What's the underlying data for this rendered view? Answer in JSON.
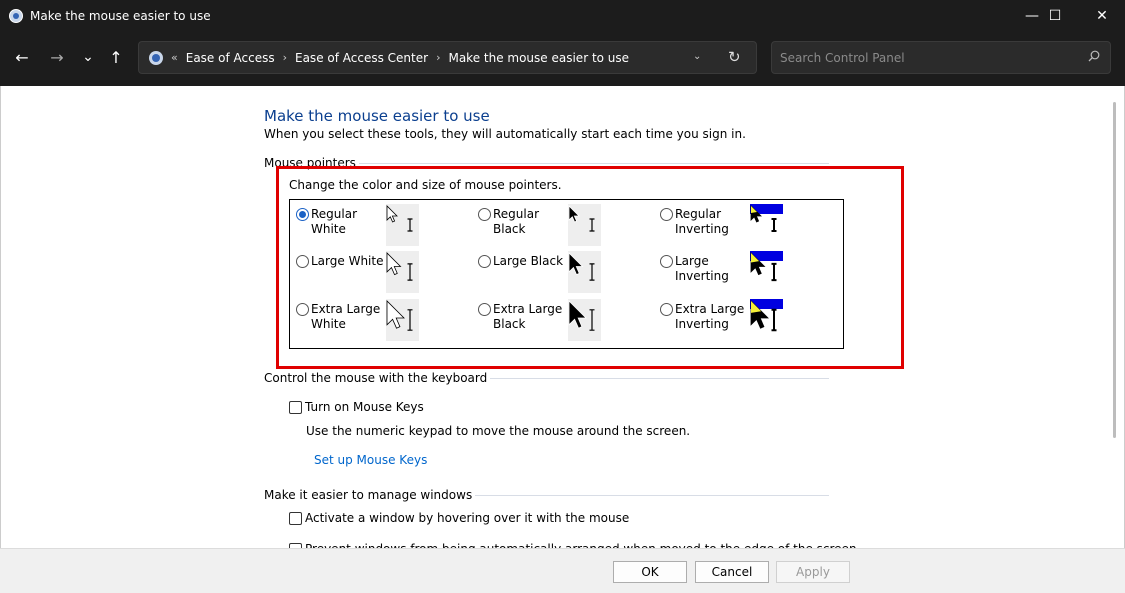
{
  "window": {
    "title": "Make the mouse easier to use",
    "controls": {
      "minimize": "—",
      "maximize": "☐",
      "close": "✕"
    }
  },
  "nav": {
    "back": "←",
    "forward": "→",
    "recent": "⌄",
    "up": "↑",
    "overflow": "«",
    "breadcrumbs": [
      "Ease of Access",
      "Ease of Access Center",
      "Make the mouse easier to use"
    ],
    "separator": "›",
    "dropdown": "⌄",
    "refresh": "↻",
    "search_placeholder": "Search Control Panel"
  },
  "page": {
    "title": "Make the mouse easier to use",
    "subtitle": "When you select these tools, they will automatically start each time you sign in."
  },
  "mouse_pointers": {
    "group_label": "Mouse pointers",
    "description": "Change the color and size of mouse pointers.",
    "options": [
      {
        "label": "Regular\nWhite",
        "checked": true,
        "scheme": "white",
        "size": "regular"
      },
      {
        "label": "Regular Black",
        "checked": false,
        "scheme": "black",
        "size": "regular"
      },
      {
        "label": "Regular\nInverting",
        "checked": false,
        "scheme": "inverting",
        "size": "regular"
      },
      {
        "label": "Large White",
        "checked": false,
        "scheme": "white",
        "size": "large"
      },
      {
        "label": "Large Black",
        "checked": false,
        "scheme": "black",
        "size": "large"
      },
      {
        "label": "Large\nInverting",
        "checked": false,
        "scheme": "inverting",
        "size": "large"
      },
      {
        "label": "Extra Large\nWhite",
        "checked": false,
        "scheme": "white",
        "size": "extra-large"
      },
      {
        "label": "Extra Large\nBlack",
        "checked": false,
        "scheme": "black",
        "size": "extra-large"
      },
      {
        "label": "Extra Large\nInverting",
        "checked": false,
        "scheme": "inverting",
        "size": "extra-large"
      }
    ]
  },
  "keyboard": {
    "group_label": "Control the mouse with the keyboard",
    "mouse_keys_label": "Turn on Mouse Keys",
    "mouse_keys_checked": false,
    "mouse_keys_help": "Use the numeric keypad to move the mouse around the screen.",
    "setup_link": "Set up Mouse Keys"
  },
  "windows": {
    "group_label": "Make it easier to manage windows",
    "hover_label": "Activate a window by hovering over it with the mouse",
    "hover_checked": false,
    "arrange_label": "Prevent windows from being automatically arranged when moved to the edge of the screen",
    "arrange_checked": false
  },
  "buttons": {
    "ok": "OK",
    "cancel": "Cancel",
    "apply": "Apply"
  },
  "colors": {
    "accent": "#1b62c6",
    "highlight": "#e00000",
    "link": "#0066cc",
    "title_blue": "#0b3f8f",
    "invert_blue": "#0000e0",
    "invert_yellow": "#f4ef37"
  }
}
